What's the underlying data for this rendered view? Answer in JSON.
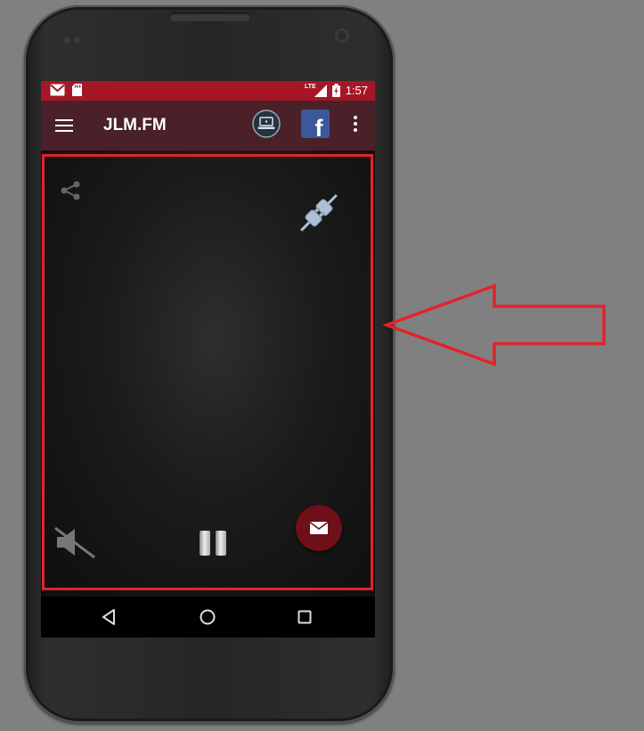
{
  "status_bar": {
    "time": "1:57",
    "network": "LTE",
    "icons": [
      "gmail-icon",
      "sd-card-icon",
      "signal-icon",
      "battery-charging-icon"
    ]
  },
  "app_bar": {
    "title": "JLM.FM",
    "icons": [
      "menu-icon",
      "laptop-icon",
      "facebook-icon",
      "overflow-menu-icon"
    ],
    "facebook_glyph": "f"
  },
  "player": {
    "icons": [
      "share-icon",
      "plug-icon",
      "mute-icon",
      "pause-icon",
      "mail-icon"
    ]
  },
  "nav_bar": {
    "icons": [
      "back-icon",
      "home-icon",
      "recents-icon"
    ]
  },
  "annotation": {
    "highlight_color": "#e3232b",
    "arrow_direction": "left"
  },
  "colors": {
    "status_bar": "#a51627",
    "app_bar": "#4a2128",
    "mail_button": "#6e0f19",
    "facebook": "#3b5998"
  }
}
